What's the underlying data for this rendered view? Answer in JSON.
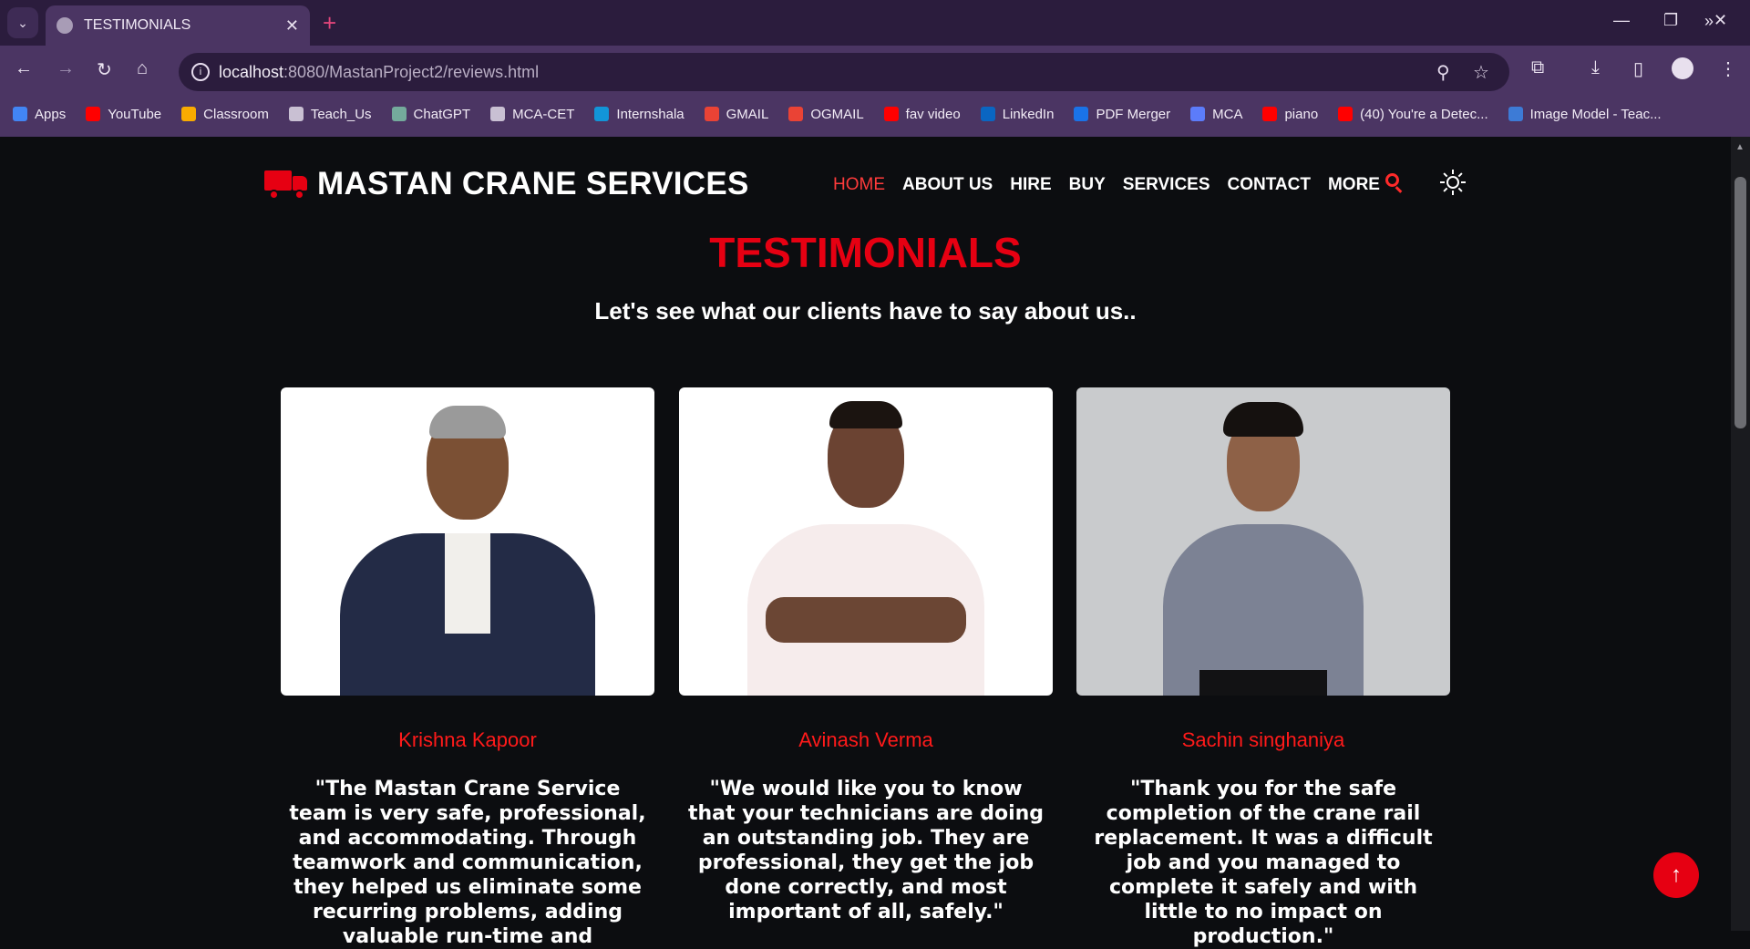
{
  "browser": {
    "tab_title": "TESTIMONIALS",
    "url_host": "localhost",
    "url_path": ":8080/MastanProject2/reviews.html",
    "bookmarks": [
      {
        "label": "Apps",
        "color": "#4285f4"
      },
      {
        "label": "YouTube",
        "color": "#ff0000"
      },
      {
        "label": "Classroom",
        "color": "#f9ab00"
      },
      {
        "label": "Teach_Us",
        "color": "#c9c0d3"
      },
      {
        "label": "ChatGPT",
        "color": "#74aa9c"
      },
      {
        "label": "MCA-CET",
        "color": "#c9c0d3"
      },
      {
        "label": "Internshala",
        "color": "#1295d8"
      },
      {
        "label": "GMAIL",
        "color": "#ea4335"
      },
      {
        "label": "OGMAIL",
        "color": "#ea4335"
      },
      {
        "label": "fav video",
        "color": "#ff0000"
      },
      {
        "label": "LinkedIn",
        "color": "#0a66c2"
      },
      {
        "label": "PDF Merger",
        "color": "#1a73e8"
      },
      {
        "label": "MCA",
        "color": "#5c7cfa"
      },
      {
        "label": "piano",
        "color": "#ff0000"
      },
      {
        "label": "(40) You're a Detec...",
        "color": "#ff0000"
      },
      {
        "label": "Image Model - Teac...",
        "color": "#3d7bd6"
      }
    ]
  },
  "site": {
    "brand": "MASTAN CRANE SERVICES",
    "nav": [
      "HOME",
      "ABOUT US",
      "HIRE",
      "BUY",
      "SERVICES",
      "CONTACT",
      "MORE"
    ],
    "accent": "#e60012",
    "title": "TESTIMONIALS",
    "subtitle": "Let's see what our clients have to say about us..",
    "testimonials": [
      {
        "name": "Krishna Kapoor",
        "quote": "\"The Mastan Crane Service team is very safe, professional, and accommodating. Through teamwork and communication, they helped us eliminate some recurring problems, adding valuable run-time and"
      },
      {
        "name": "Avinash Verma",
        "quote": "\"We would like you to know that your technicians are doing an outstanding job. They are professional, they get the job done correctly, and most important of all, safely.\""
      },
      {
        "name": "Sachin singhaniya",
        "quote": "\"Thank you for the safe completion of the crane rail replacement. It was a difficult job and you managed to complete it safely and with little to no impact on production.\""
      }
    ]
  }
}
